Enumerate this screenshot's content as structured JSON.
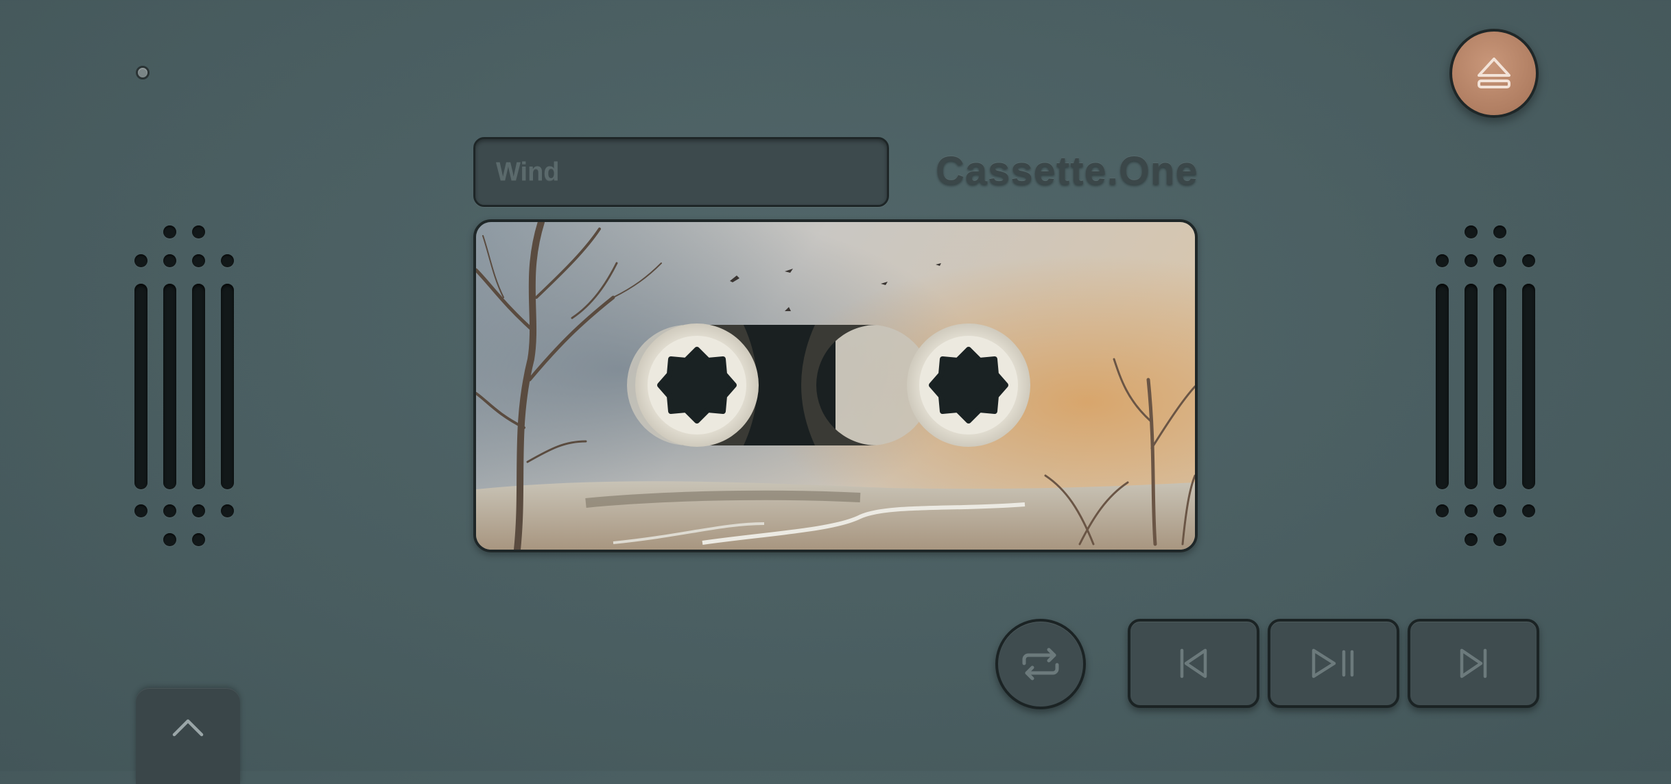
{
  "app": {
    "brand": "Cassette.One",
    "track_title": "Wind"
  },
  "icons": {
    "eject": "eject-icon",
    "repeat": "repeat-icon",
    "previous": "skip-previous-icon",
    "play_pause": "play-pause-icon",
    "next": "skip-next-icon",
    "expand": "chevron-up-icon"
  },
  "colors": {
    "body": "#4a5e61",
    "eject_button": "#b98a6e",
    "button": "#3f4c4f",
    "icon_stroke": "#6c7a7c"
  }
}
